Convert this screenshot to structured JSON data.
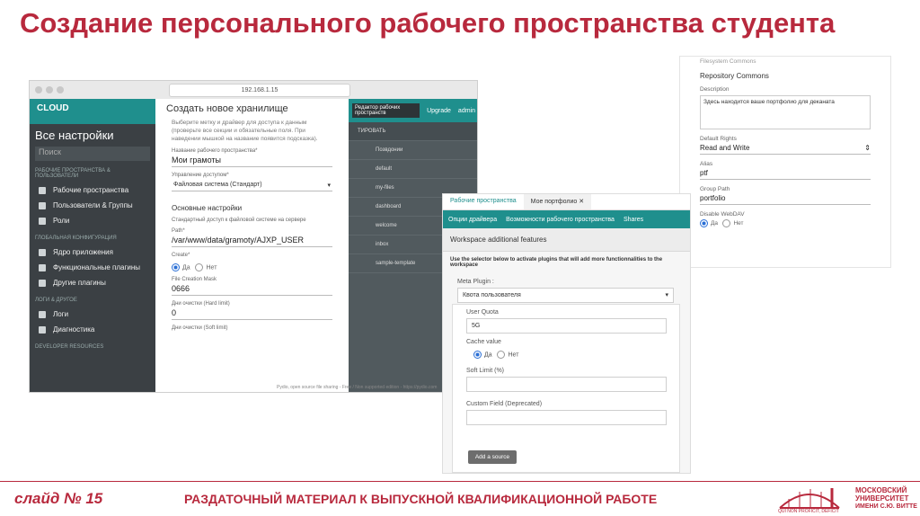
{
  "slide_title": "Создание персонального рабочего пространства студента",
  "footer": {
    "slide_number_label": "слайд №",
    "slide_number": "15",
    "handout_text": "РАЗДАТОЧНЫЙ МАТЕРИАЛ К ВЫПУСКНОЙ КВАЛИФИКАЦИОННОЙ РАБОТЕ"
  },
  "logo": {
    "line1": "МОСКОВСКИЙ",
    "line2": "УНИВЕРСИТЕТ",
    "line3": "ИМЕНИ С.Ю. ВИТТЕ",
    "motto": "QUI NON PROFICIT, DEFICIT"
  },
  "window_a": {
    "url": "192.168.1.15",
    "brand": "CLOUD",
    "sidebar": {
      "title": "Все настройки",
      "search_placeholder": "Поиск",
      "section1": "РАБОЧИЕ ПРОСТРАНСТВА & ПОЛЬЗОВАТЕЛИ",
      "items1": [
        "Рабочие пространства",
        "Пользователи & Группы",
        "Роли"
      ],
      "section2": "ГЛОБАЛЬНАЯ КОНФИГУРАЦИЯ",
      "items2": [
        "Ядро приложения",
        "Функциональные плагины",
        "Другие плагины"
      ],
      "section3": "ЛОГИ & ДРУГОЕ",
      "items3": [
        "Логи",
        "Диагностика"
      ],
      "section4": "DEVELOPER RESOURCES"
    },
    "form": {
      "title": "Создать новое хранилище",
      "hint": "Выберите метку и драйвер для доступа к данным (проверьте все секции и обязательные поля. При наведении мышкой на название появится подсказка).",
      "name_label": "Название рабочего пространства*",
      "name_value": "Мои грамоты",
      "access_label": "Управление доступом*",
      "access_value": "Файловая система (Стандарт)",
      "section": "Основные настройки",
      "std_hint": "Стандартный доступ к файловой системе на сервере",
      "path_label": "Path*",
      "path_value": "/var/www/data/gramoty/AJXP_USER",
      "create_label": "Create*",
      "yes": "Да",
      "no": "Нет",
      "mask_label": "File Creation Mask",
      "mask_value": "0666",
      "hard_label": "Дни очистки (Hard limit)",
      "hard_value": "0",
      "soft_label": "Дни очистки (Soft limit)"
    },
    "right": {
      "editor": "Редактор рабочих пространств",
      "upgrade": "Upgrade",
      "admin": "admin",
      "column": "ТИРОВАТЬ",
      "rows": [
        "Позвдонии",
        "default",
        "my-files",
        "dashboard",
        "welcome",
        "inbox",
        "sample-template"
      ],
      "footer": "Pydio, open source file sharing - Free / Non supported edition - https://pydio.com"
    }
  },
  "window_b": {
    "filesystem": "Filesystem Commons",
    "repository": "Repository Commons",
    "desc_label": "Description",
    "desc_value": "Здесь находится ваше портфолио для деканата",
    "rights_label": "Default Rights",
    "rights_value": "Read and Write",
    "alias_label": "Alias",
    "alias_value": "ptf",
    "group_label": "Group Path",
    "group_value": "portfolio",
    "webdav_label": "Disable WebDAV",
    "yes": "Да",
    "no": "Нет"
  },
  "window_c": {
    "tab1": "Рабочие пространства",
    "tab2": "Мое портфолио",
    "bar1": "Опции драйвера",
    "bar2": "Возможности рабочего пространства",
    "bar3": "Shares",
    "header": "Workspace additional features",
    "description": "Use the selector below to activate plugins that will add more functionnalities to the workspace",
    "meta_label": "Meta Plugin :",
    "meta_value": "Квота пользователя",
    "quota_label": "User Quota",
    "quota_value": "5G",
    "cache_label": "Cache value",
    "yes": "Да",
    "no": "Нет",
    "soft_label": "Soft Limit (%)",
    "custom_label": "Custom Field (Deprecated)",
    "button": "Add a source"
  }
}
